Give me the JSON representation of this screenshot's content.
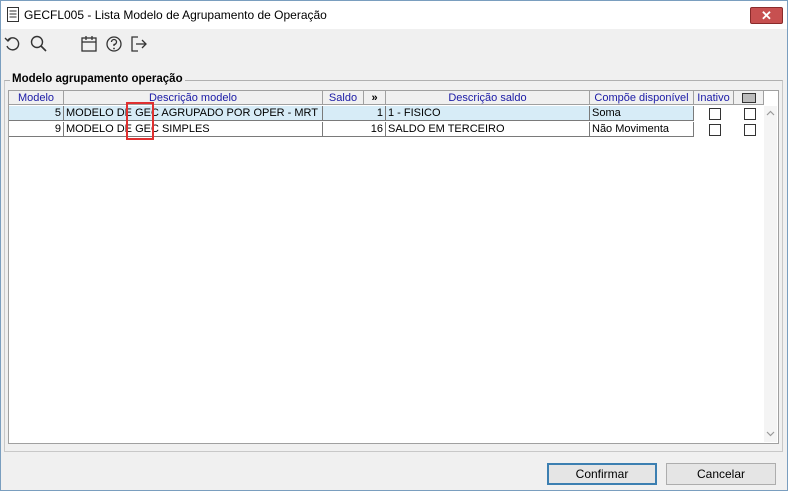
{
  "window": {
    "title": "GECFL005 - Lista Modelo de Agrupamento de Operação",
    "close_glyph": "✕"
  },
  "toolbar": {
    "icons": [
      "refresh-icon",
      "search-icon",
      "calendar-icon",
      "help-icon",
      "exit-icon"
    ]
  },
  "group": {
    "legend": "Modelo agrupamento operação"
  },
  "grid": {
    "columns": {
      "modelo": "Modelo",
      "descricao_modelo": "Descrição modelo",
      "saldo": "Saldo",
      "expand": "»",
      "descricao_saldo": "Descrição saldo",
      "compoe": "Compõe disponível",
      "inativo": "Inativo"
    },
    "rows": [
      {
        "modelo": "5",
        "descricao_modelo": "MODELO DE GEC AGRUPADO POR OPER - MRT",
        "saldo": "1",
        "descricao_saldo": "1 - FISICO",
        "compoe": "Soma",
        "inativo": false,
        "selected": false
      },
      {
        "modelo": "9",
        "descricao_modelo": "MODELO DE GEC SIMPLES",
        "saldo": "16",
        "descricao_saldo": "SALDO EM TERCEIRO",
        "compoe": "Não Movimenta",
        "inativo": false,
        "selected": false
      }
    ]
  },
  "buttons": {
    "confirm": "Confirmar",
    "cancel": "Cancelar"
  },
  "colors": {
    "header_text": "#1a1aa6",
    "selected_row": "#d7ecf7",
    "highlight": "#e03030",
    "close": "#c75050"
  }
}
